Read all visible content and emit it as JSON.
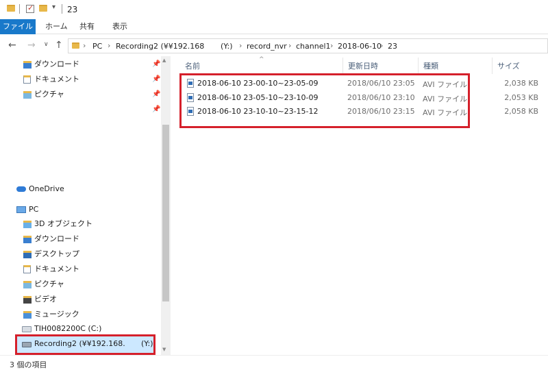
{
  "window": {
    "title": "23"
  },
  "ribbon": {
    "tabs": [
      "ファイル",
      "ホーム",
      "共有",
      "表示"
    ]
  },
  "address": {
    "crumbs": [
      "PC",
      "Recording2 (¥¥192.168",
      "(Y:)",
      "record_nvr",
      "channel1",
      "2018-06-10",
      "23"
    ]
  },
  "nav": {
    "quick_access": [
      {
        "label": "ダウンロード",
        "icon": "downloads-icon"
      },
      {
        "label": "ドキュメント",
        "icon": "documents-icon"
      },
      {
        "label": "ピクチャ",
        "icon": "pictures-icon"
      }
    ],
    "onedrive": "OneDrive",
    "pc": "PC",
    "pc_items": [
      {
        "label": "3D オブジェクト",
        "icon": "3d-objects-icon"
      },
      {
        "label": "ダウンロード",
        "icon": "downloads-icon"
      },
      {
        "label": "デスクトップ",
        "icon": "desktop-icon"
      },
      {
        "label": "ドキュメント",
        "icon": "documents-icon"
      },
      {
        "label": "ピクチャ",
        "icon": "pictures-icon"
      },
      {
        "label": "ビデオ",
        "icon": "videos-icon"
      },
      {
        "label": "ミュージック",
        "icon": "music-icon"
      },
      {
        "label": "TIH0082200C (C:)",
        "icon": "local-drive-icon"
      }
    ],
    "network_drive": {
      "label": "Recording2 (¥¥192.168.",
      "suffix": "(Y:)"
    }
  },
  "columns": {
    "name": "名前",
    "date": "更新日時",
    "type": "種類",
    "size": "サイズ"
  },
  "files": [
    {
      "name": "2018-06-10 23-00-10~23-05-09",
      "date": "2018/06/10 23:05",
      "type": "AVI ファイル",
      "size": "2,038 KB"
    },
    {
      "name": "2018-06-10 23-05-10~23-10-09",
      "date": "2018/06/10 23:10",
      "type": "AVI ファイル",
      "size": "2,053 KB"
    },
    {
      "name": "2018-06-10 23-10-10~23-15-12",
      "date": "2018/06/10 23:15",
      "type": "AVI ファイル",
      "size": "2,058 KB"
    }
  ],
  "status": {
    "count": "3 個の項目"
  },
  "colors": {
    "accent": "#1979ca",
    "highlight": "#d5202b",
    "selection": "#cce8ff"
  }
}
